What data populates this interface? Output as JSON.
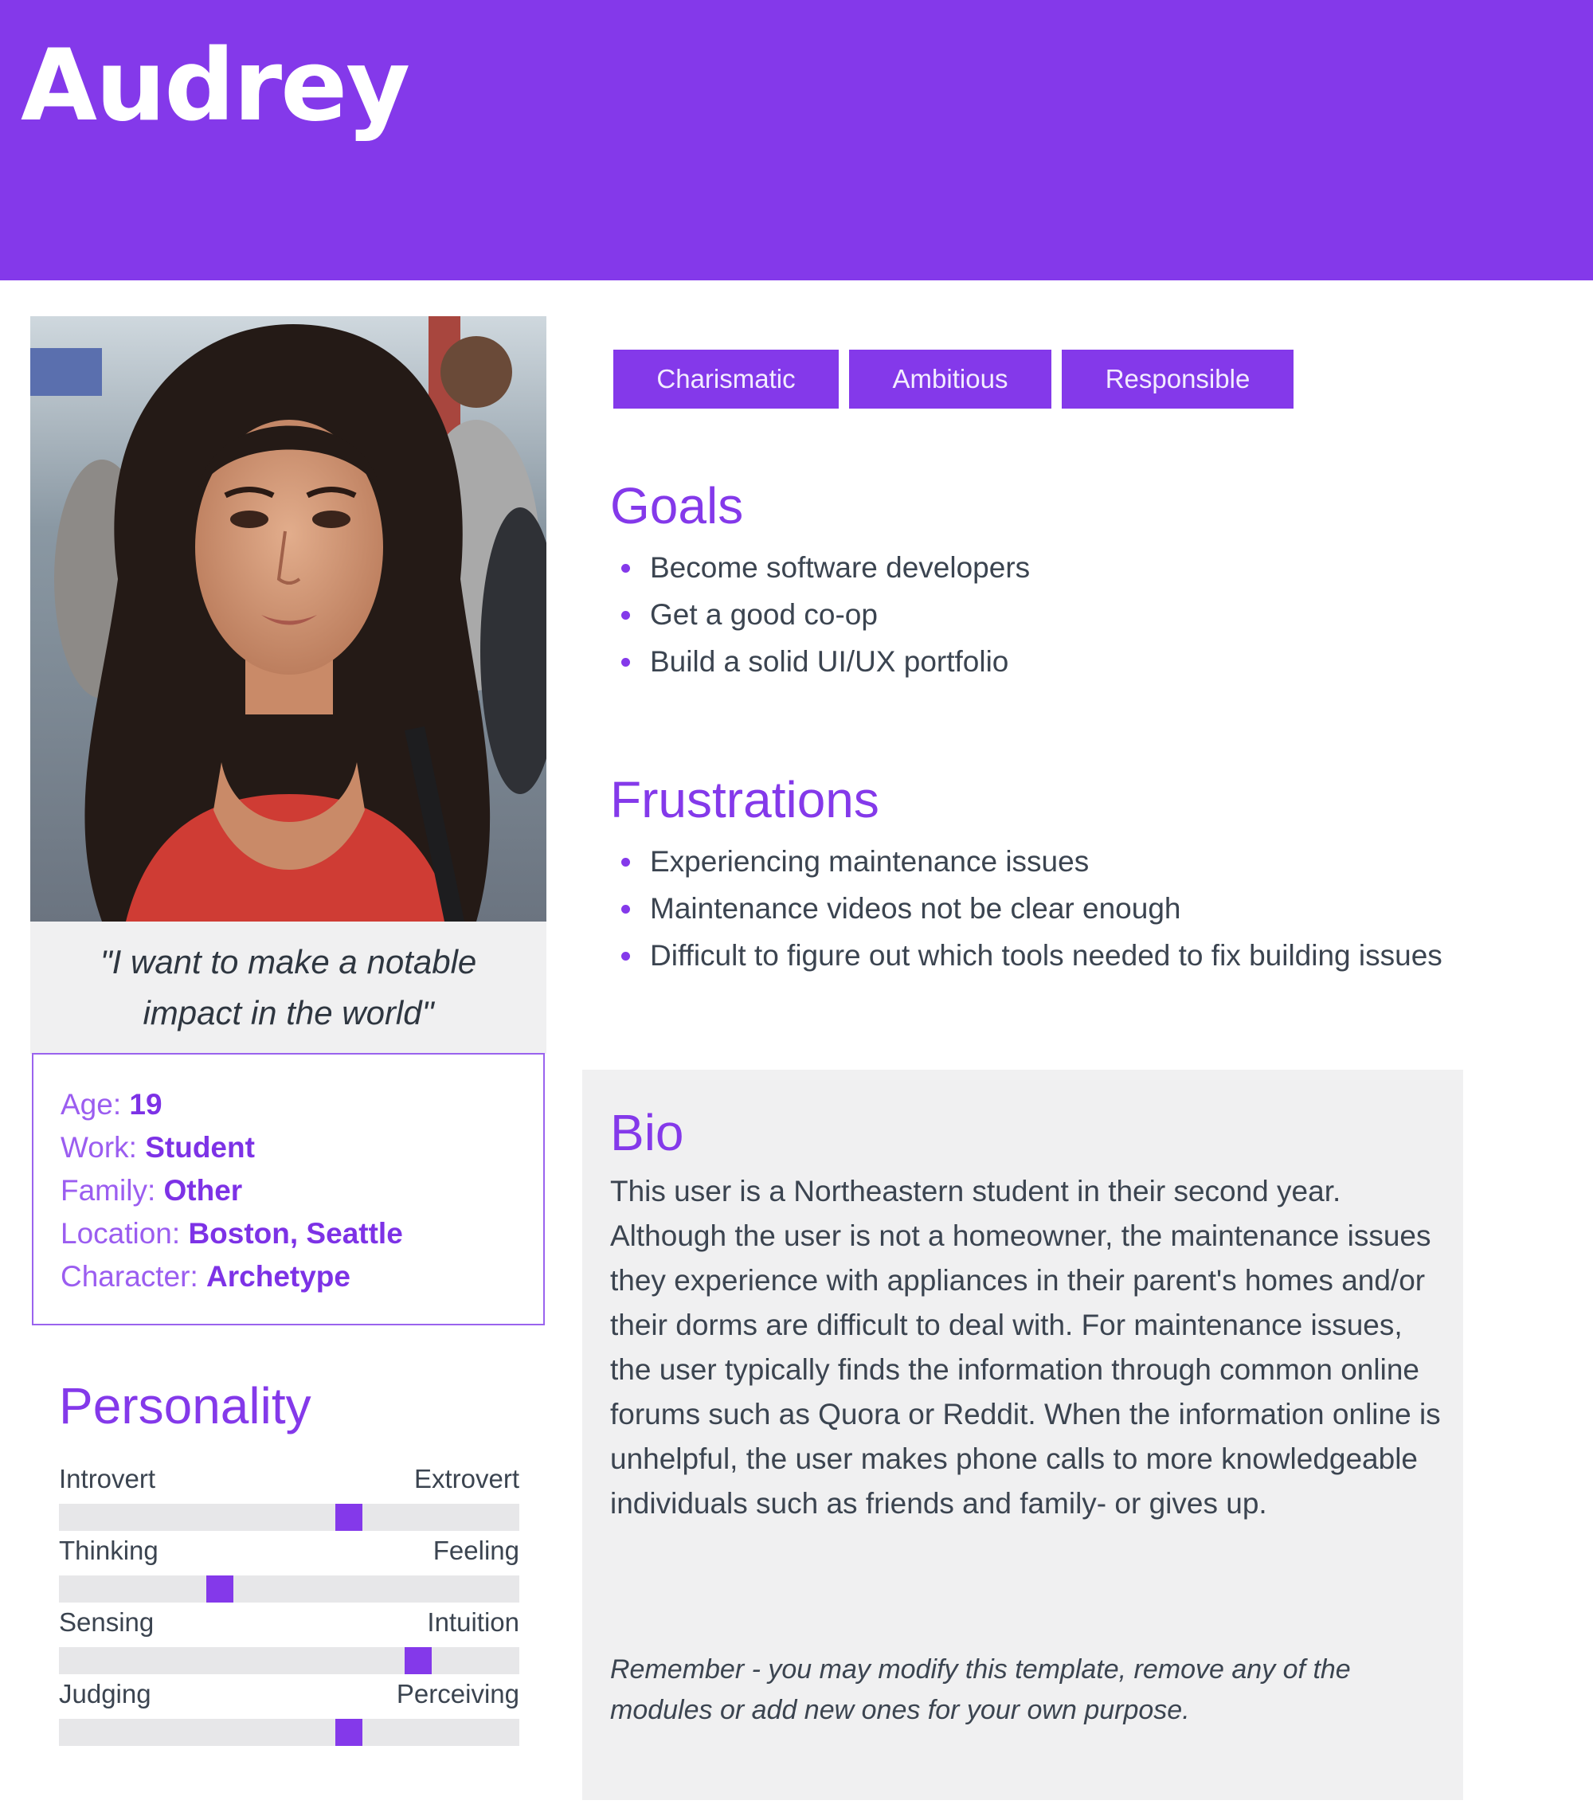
{
  "persona": {
    "name": "Audrey"
  },
  "photo": {
    "alt_icon": "persona-portrait"
  },
  "quote": "\"I want to make a notable impact in the world\"",
  "info": [
    {
      "label": "Age:",
      "value": "19"
    },
    {
      "label": "Work:",
      "value": "Student"
    },
    {
      "label": "Family:",
      "value": "Other"
    },
    {
      "label": "Location:",
      "value": "Boston, Seattle"
    },
    {
      "label": "Character:",
      "value": "Archetype"
    }
  ],
  "personality": {
    "title": "Personality",
    "traits": [
      {
        "left": "Introvert",
        "right": "Extrovert",
        "level": 0.63
      },
      {
        "left": "Thinking",
        "right": "Feeling",
        "level": 0.35
      },
      {
        "left": "Sensing",
        "right": "Intuition",
        "level": 0.78
      },
      {
        "left": "Judging",
        "right": "Perceiving",
        "level": 0.63
      }
    ]
  },
  "tags": [
    "Charismatic",
    "Ambitious",
    "Responsible"
  ],
  "goals": {
    "title": "Goals",
    "items": [
      "Become software developers",
      "Get  a good co-op",
      "Build a solid UI/UX portfolio"
    ]
  },
  "frustrations": {
    "title": "Frustrations",
    "items": [
      "Experiencing maintenance issues",
      "Maintenance videos not be clear enough",
      "Difficult to figure out which tools needed to fix building issues"
    ]
  },
  "bio": {
    "title": "Bio",
    "text": "This user is a Northeastern student in their second year. Although the user is not a homeowner, the maintenance issues they experience with appliances in their parent's homes and/or their dorms are difficult to deal with. For maintenance issues, the user typically finds the information through common online forums such as Quora or Reddit. When the information online is unhelpful, the user makes phone calls to more knowledgeable individuals such as friends and family- or gives up.",
    "note": "Remember - you may modify this template, remove any of the modules or add new ones for your own purpose."
  },
  "colors": {
    "accent": "#8439ea",
    "panel": "#f0f0f1",
    "track": "#e7e7e9",
    "text": "#3b4450"
  }
}
